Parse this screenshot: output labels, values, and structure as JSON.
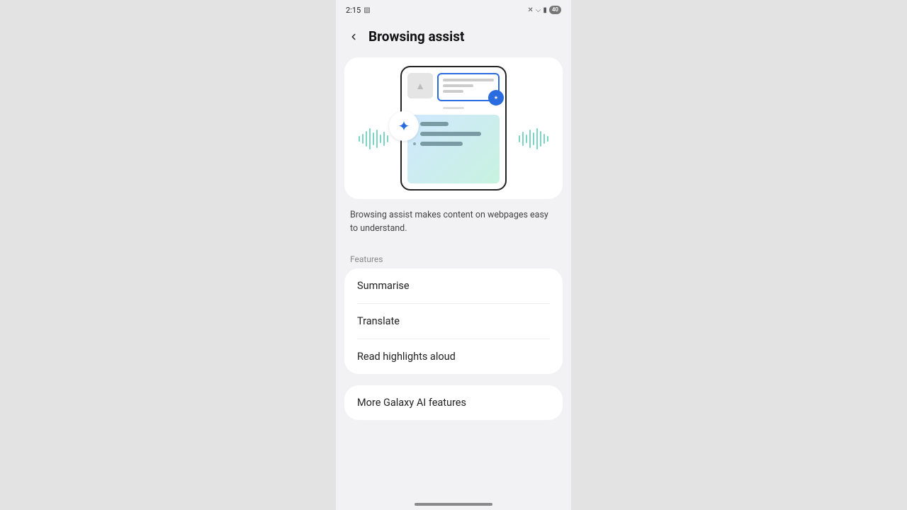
{
  "statusbar": {
    "time": "2:15",
    "battery": "40"
  },
  "header": {
    "title": "Browsing assist"
  },
  "description": "Browsing assist makes content on webpages easy to understand.",
  "section_label": "Features",
  "features": [
    {
      "label": "Summarise"
    },
    {
      "label": "Translate"
    },
    {
      "label": "Read highlights aloud"
    }
  ],
  "more": {
    "label": "More Galaxy AI features"
  }
}
